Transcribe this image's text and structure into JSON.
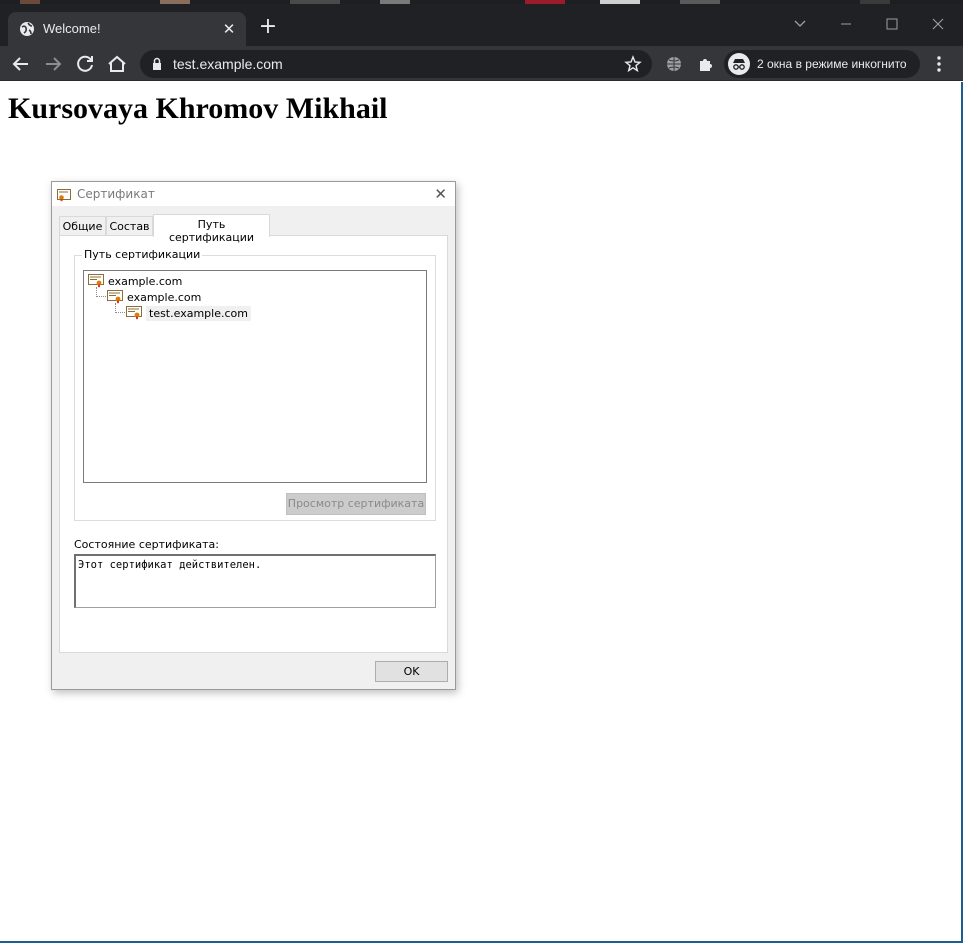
{
  "browser": {
    "tab_title": "Welcome!",
    "url": "test.example.com",
    "incognito_label": "2 окна в режиме инкогнито"
  },
  "page": {
    "heading": "Kursovaya Khromov Mikhail"
  },
  "dialog": {
    "title": "Сертификат",
    "tabs": [
      {
        "label": "Общие"
      },
      {
        "label": "Состав"
      },
      {
        "label": "Путь сертификации",
        "active": true
      }
    ],
    "path_group_label": "Путь сертификации",
    "chain": [
      {
        "name": "example.com",
        "level": 0
      },
      {
        "name": "example.com",
        "level": 1
      },
      {
        "name": "test.example.com",
        "level": 2,
        "selected": true
      }
    ],
    "view_button_label": "Просмотр сертификата",
    "status_label": "Состояние сертификата:",
    "status_text": "Этот сертификат действителен.",
    "ok_label": "OK"
  }
}
